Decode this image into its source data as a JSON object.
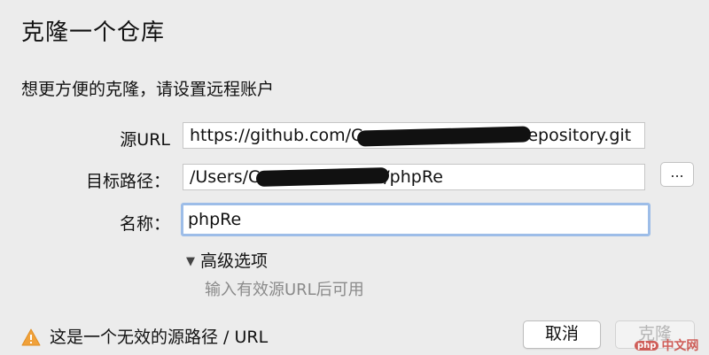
{
  "dialog": {
    "title": "克隆一个仓库",
    "subtitle": "想更方便的克隆，请设置远程账户"
  },
  "form": {
    "source_url": {
      "label": "源URL",
      "value_start": "https://github.com/C",
      "value_end": "epository.git"
    },
    "target_path": {
      "label": "目标路径：",
      "value_start": "/Users/C",
      "value_end": "/phpRe",
      "browse_label": "..."
    },
    "name": {
      "label": "名称：",
      "value": "phpRe"
    }
  },
  "advanced": {
    "label": "高级选项",
    "hint": "输入有效源URL后可用"
  },
  "status": {
    "warning_text": "这是一个无效的源路径 / URL",
    "warning_color": "#f0a13a"
  },
  "buttons": {
    "cancel_label": "取消",
    "clone_label": "克隆"
  },
  "watermark": {
    "badge": "php",
    "text": "中文网"
  }
}
